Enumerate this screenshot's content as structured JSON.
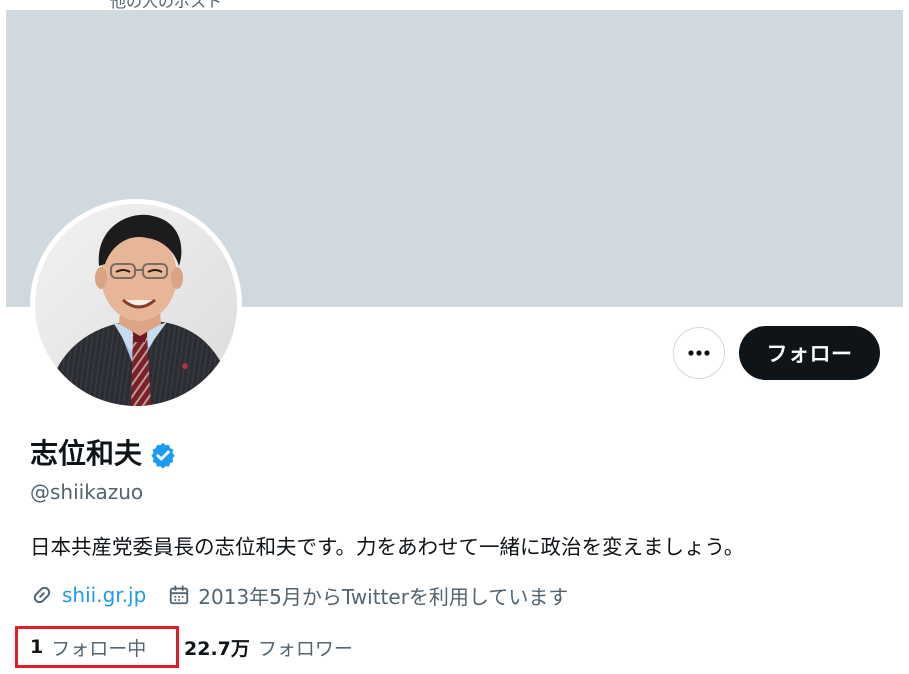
{
  "top_partial_text": "他の人のポスト",
  "profile": {
    "display_name": "志位和夫",
    "handle": "@shiikazuo",
    "bio": "日本共産党委員長の志位和夫です。力をあわせて一緒に政治を変えましょう。",
    "website_label": "shii.gr.jp",
    "joined": "2013年5月からTwitterを利用しています",
    "verified": true
  },
  "actions": {
    "more_icon": "more-horizontal-icon",
    "follow_label": "フォロー"
  },
  "stats": {
    "following_count": "1",
    "following_label": "フォロー中",
    "followers_count": "22.7万",
    "followers_label": "フォロワー"
  },
  "colors": {
    "banner": "#cfd9de",
    "accent_blue": "#1d9bf0",
    "follow_button_bg": "#0f1419",
    "highlight_box": "#e11d2a",
    "secondary_text": "#536471"
  },
  "icons": {
    "verified": "verified-badge-icon",
    "link": "link-icon",
    "calendar": "calendar-icon"
  }
}
